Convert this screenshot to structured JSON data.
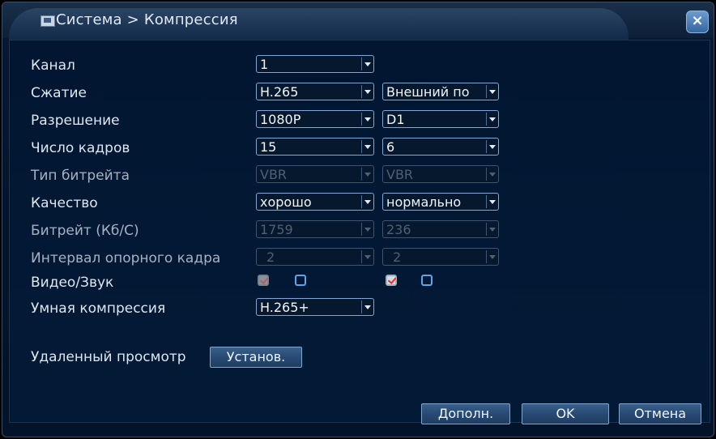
{
  "window": {
    "title": "Система > Компрессия",
    "close_icon": "close-icon"
  },
  "form": {
    "rows": [
      {
        "label": "Канал",
        "main": "1",
        "extra": null
      },
      {
        "label": "Сжатие",
        "main": "H.265",
        "extra": "Внешний по"
      },
      {
        "label": "Разрешение",
        "main": "1080P",
        "extra": "D1"
      },
      {
        "label": "Число кадров",
        "main": "15",
        "extra": "6"
      },
      {
        "label": "Тип битрейта",
        "main": "VBR",
        "extra": "VBR"
      },
      {
        "label": "Качество",
        "main": "хорошо",
        "extra": "нормально"
      },
      {
        "label": "Битрейт (Кб/С)",
        "main": "1759",
        "extra": "236"
      },
      {
        "label": "Интервал опорного кадра",
        "main": "2",
        "extra": "2"
      },
      {
        "label": "Видео/Звук",
        "main_video": true,
        "main_audio": false,
        "extra_video": true,
        "extra_audio": false
      },
      {
        "label": "Умная компрессия",
        "main": "H.265+",
        "extra": null
      }
    ],
    "remote_view_label": "Удаленный просмотр",
    "setup_button": "Установ."
  },
  "footer": {
    "more_button": "Дополн.",
    "ok_button": "OK",
    "cancel_button": "Отмена"
  }
}
